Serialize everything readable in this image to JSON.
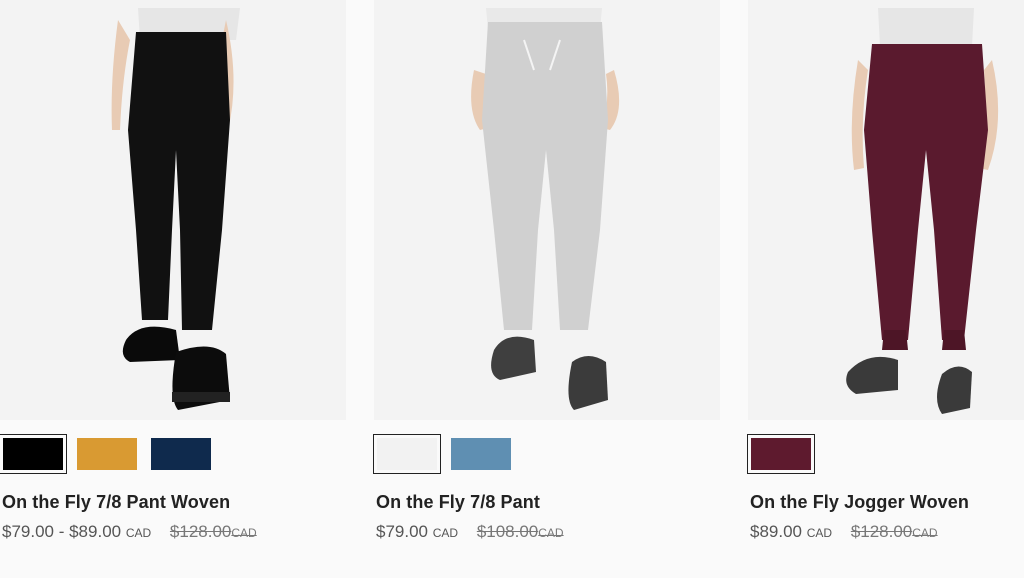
{
  "products": [
    {
      "name": "On the Fly 7/8 Pant Woven",
      "price": "$79.00 - $89.00",
      "currency": "CAD",
      "original_price": "$128.00",
      "original_currency": "CAD",
      "swatches": [
        "#000000",
        "#d99a32",
        "#0f2a4d"
      ],
      "selected_swatch": 0
    },
    {
      "name": "On the Fly 7/8 Pant",
      "price": "$79.00",
      "currency": "CAD",
      "original_price": "$108.00",
      "original_currency": "CAD",
      "swatches": [
        "#f2f2f2",
        "#5f8fb2"
      ],
      "selected_swatch": 0
    },
    {
      "name": "On the Fly Jogger Woven",
      "price": "$89.00",
      "currency": "CAD",
      "original_price": "$128.00",
      "original_currency": "CAD",
      "swatches": [
        "#5e1a2e"
      ],
      "selected_swatch": 0
    }
  ]
}
